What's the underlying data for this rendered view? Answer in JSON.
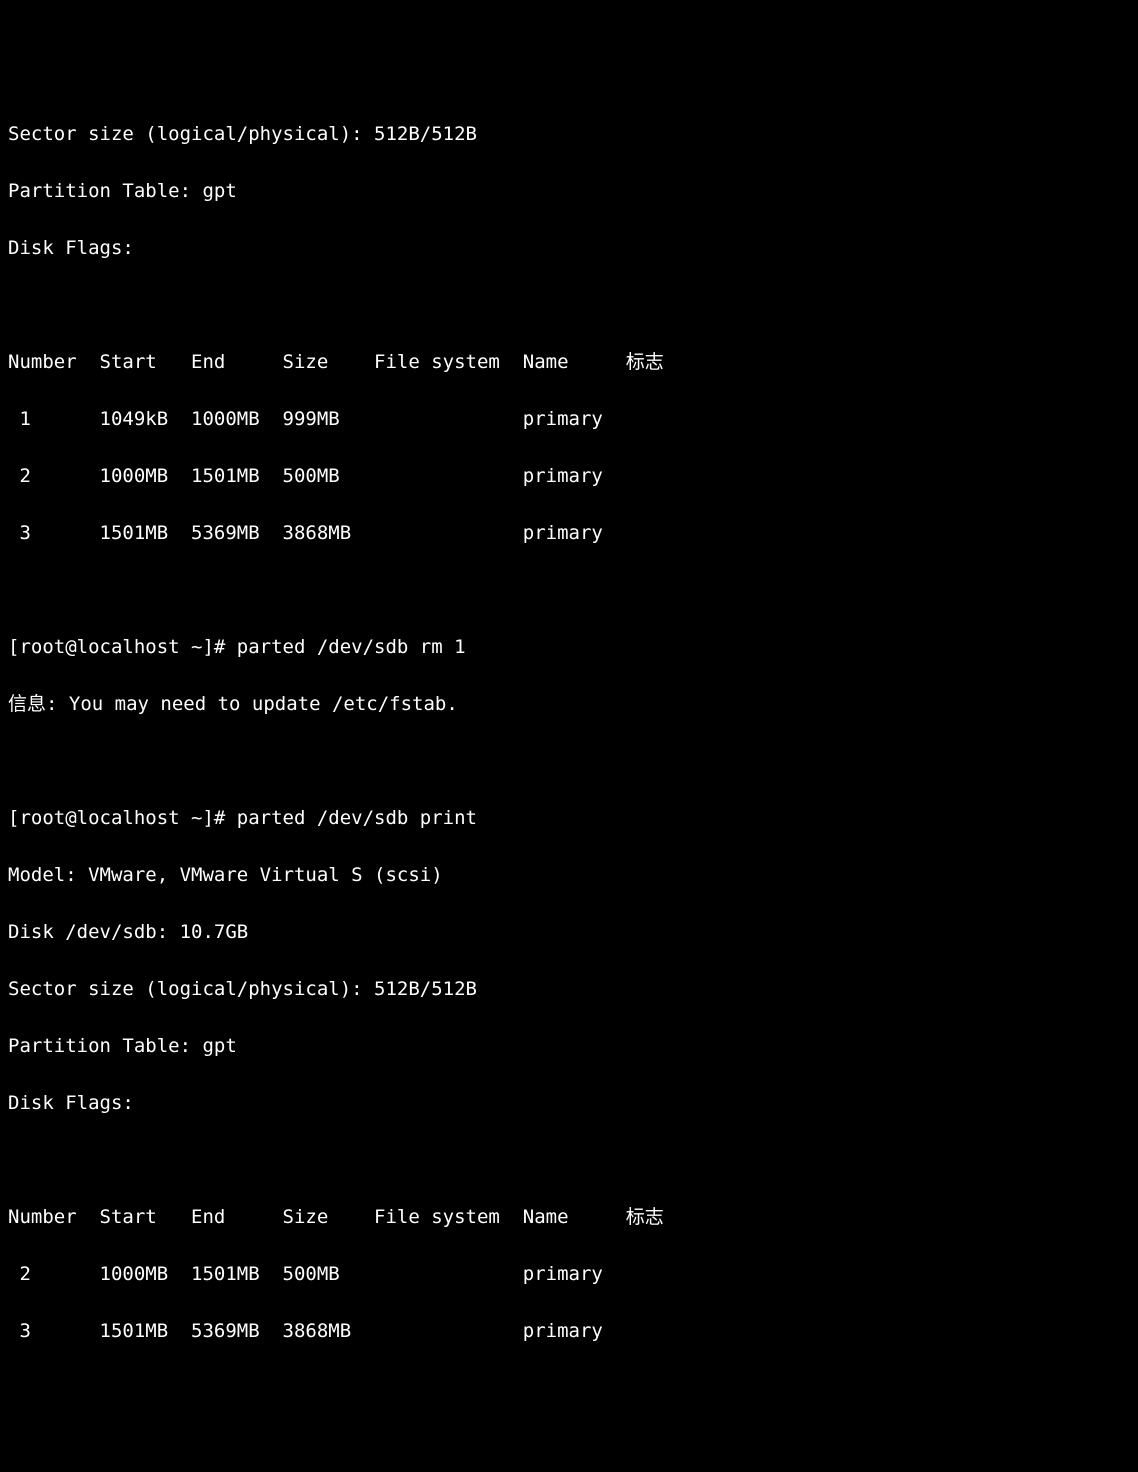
{
  "block1": {
    "sector": "Sector size (logical/physical): 512B/512B",
    "ptable": "Partition Table: gpt",
    "flags": "Disk Flags:"
  },
  "table1": {
    "header": "Number  Start   End     Size    File system  Name     标志",
    "rows": [
      " 1      1049kB  1000MB  999MB                primary",
      " 2      1000MB  1501MB  500MB                primary",
      " 3      1501MB  5369MB  3868MB               primary"
    ]
  },
  "cmd1": {
    "prompt": "[root@localhost ~]# parted /dev/sdb rm 1",
    "msg": "信息: You may need to update /etc/fstab."
  },
  "cmd2": {
    "prompt": "[root@localhost ~]# parted /dev/sdb print",
    "model": "Model: VMware, VMware Virtual S (scsi)",
    "disk": "Disk /dev/sdb: 10.7GB",
    "sector": "Sector size (logical/physical): 512B/512B",
    "ptable": "Partition Table: gpt",
    "flags": "Disk Flags:"
  },
  "table2": {
    "header": "Number  Start   End     Size    File system  Name     标志",
    "rows": [
      " 2      1000MB  1501MB  500MB                primary",
      " 3      1501MB  5369MB  3868MB               primary"
    ]
  }
}
